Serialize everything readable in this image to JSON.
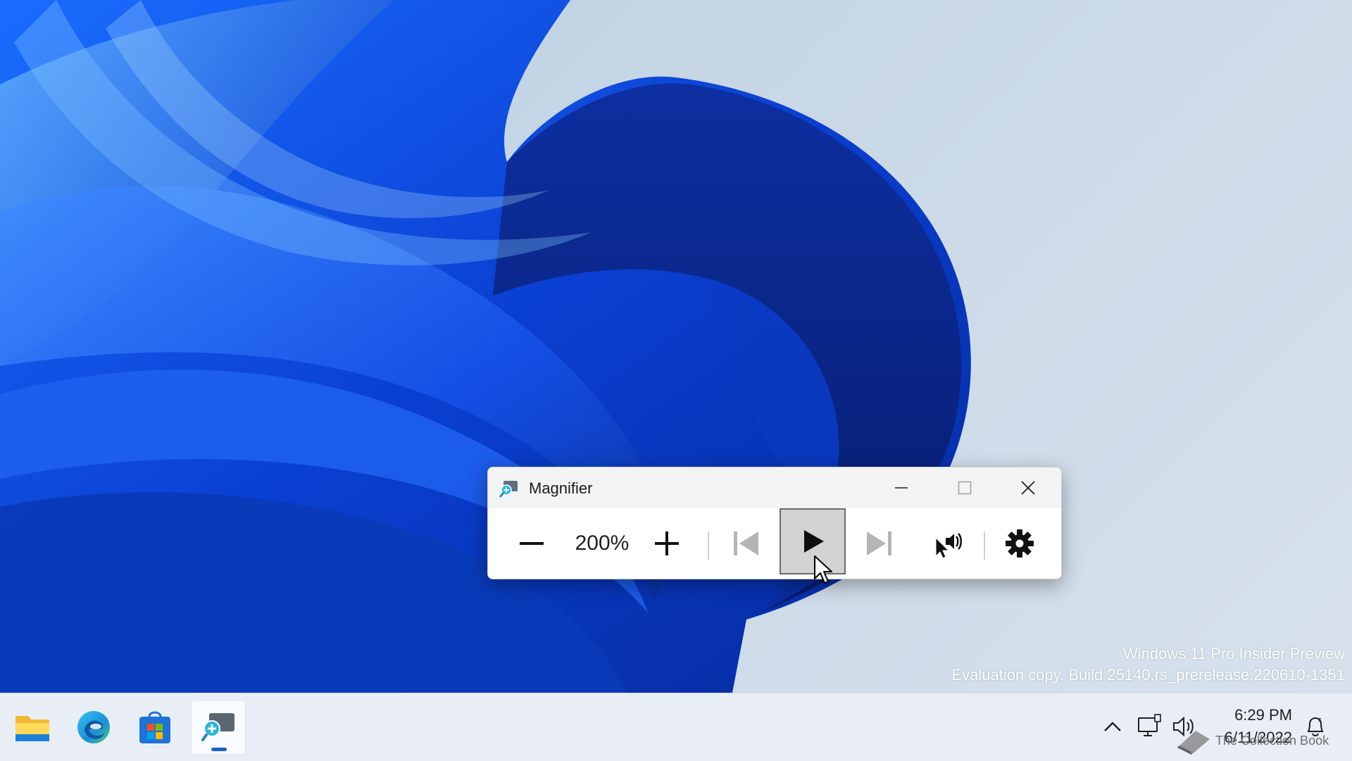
{
  "magnifier": {
    "title": "Magnifier",
    "zoom_level": "200%",
    "icons": [
      "zoom-out-icon",
      "zoom-in-icon",
      "previous-icon",
      "play-icon",
      "next-icon",
      "read-from-here-icon",
      "settings-icon"
    ]
  },
  "watermark": {
    "line1": "Windows 11 Pro Insider Preview",
    "line2": "Evaluation copy. Build 25140.rs_prerelease.220610-1351"
  },
  "taskbar": {
    "apps": [
      "file-explorer",
      "edge",
      "microsoft-store",
      "magnifier"
    ],
    "active_app": "magnifier",
    "time": "6:29 PM",
    "date": "6/11/2022"
  },
  "book_watermark": "The Collection Book",
  "colors": {
    "accent": "#1a5ecb",
    "wallpaper_blue": "#0a3fd1",
    "play_highlight": "#d3d3d3"
  }
}
